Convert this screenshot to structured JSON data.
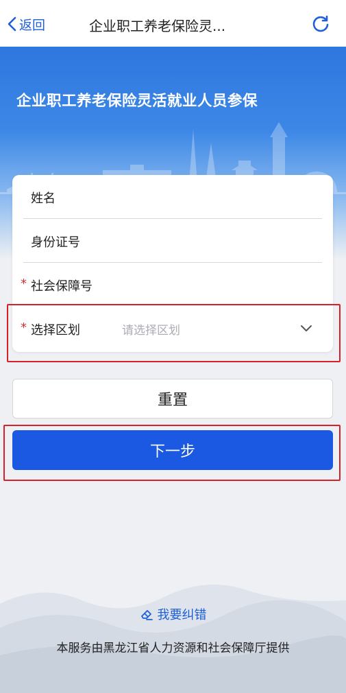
{
  "nav": {
    "back_label": "返回",
    "title": "企业职工养老保险灵..."
  },
  "hero": {
    "title": "企业职工养老保险灵活就业人员参保"
  },
  "form": {
    "fields": [
      {
        "label": "姓名",
        "required": false
      },
      {
        "label": "身份证号",
        "required": false
      },
      {
        "label": "社会保障号",
        "required": true
      },
      {
        "label": "选择区划",
        "required": true,
        "placeholder": "请选择区划"
      }
    ],
    "required_mark": "*"
  },
  "buttons": {
    "reset": "重置",
    "next": "下一步"
  },
  "footer": {
    "feedback": "我要纠错",
    "provider": "本服务由黑龙江省人力资源和社会保障厅提供"
  },
  "colors": {
    "accent": "#1b59e2",
    "highlight": "#d7202a",
    "required": "#d03030"
  },
  "icons": {
    "back": "chevron-left-icon",
    "refresh": "refresh-icon",
    "dropdown": "chevron-down-icon",
    "feedback": "eraser-icon"
  }
}
